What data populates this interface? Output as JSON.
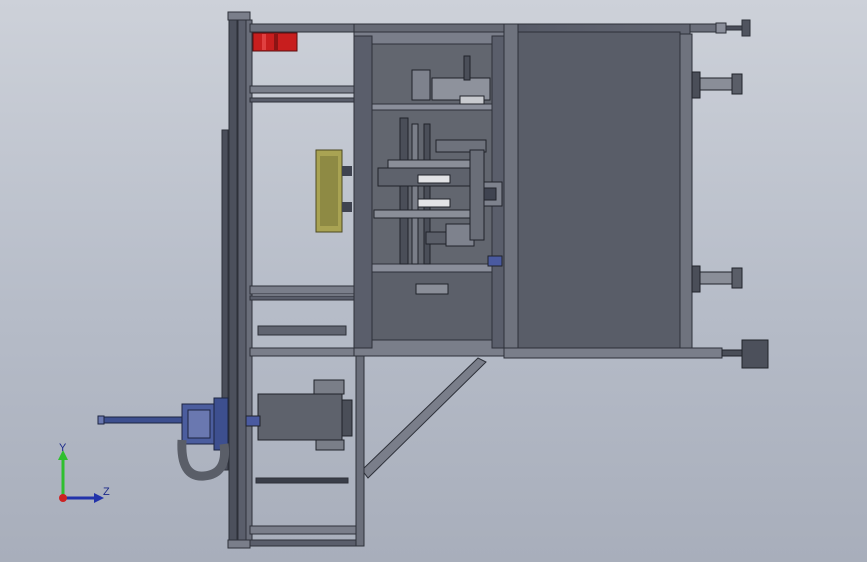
{
  "app": {
    "viewport_name": "cad-graphics-area",
    "background_top": "#cdd1d9",
    "background_bottom": "#a8aebb"
  },
  "colors": {
    "frame_dark": "#3f4350",
    "frame_mid": "#5a5e6b",
    "frame_light": "#8a8e9a",
    "panel_fill": "#6e717c",
    "cabinet_fill": "#5f636e",
    "cylinder_red": "#c81e1e",
    "cylinder_yellow": "#a9a353",
    "spindle_blue": "#3d4f8f"
  },
  "triad": {
    "y_label": "Y",
    "z_label": "Z",
    "y_color": "#2fbf2f",
    "z_color": "#2233aa",
    "origin_color": "#cc2222"
  }
}
